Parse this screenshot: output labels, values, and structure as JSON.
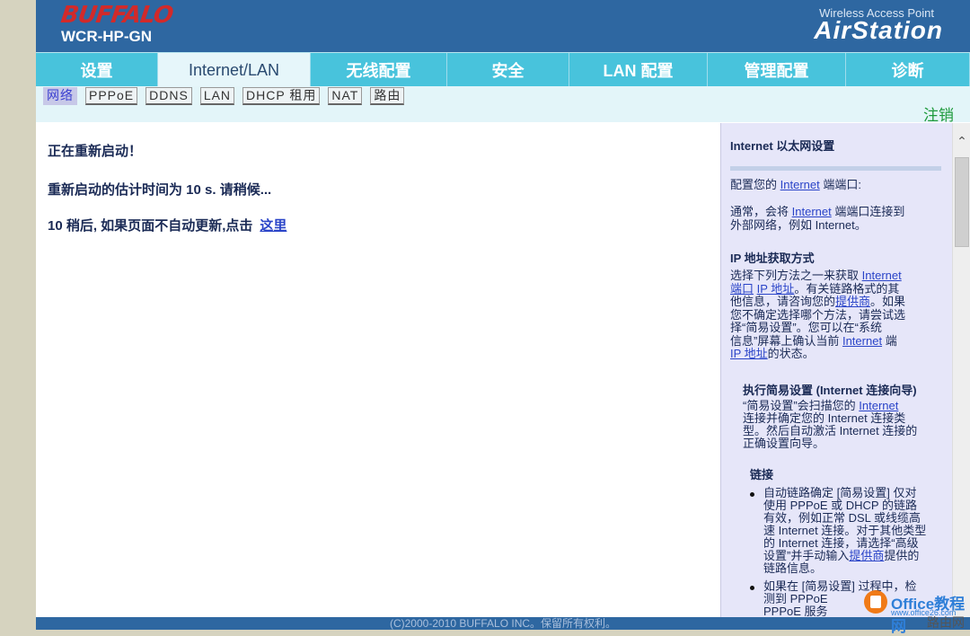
{
  "header": {
    "brand": "BUFFALO",
    "model": "WCR-HP-GN",
    "product_sub": "Wireless Access Point",
    "product": "AirStation"
  },
  "nav": {
    "tabs": [
      {
        "label": "设置",
        "active": false
      },
      {
        "label": "Internet/LAN",
        "active": true
      },
      {
        "label": "无线配置",
        "active": false
      },
      {
        "label": "安全",
        "active": false
      },
      {
        "label": "LAN 配置",
        "active": false
      },
      {
        "label": "管理配置",
        "active": false
      },
      {
        "label": "诊断",
        "active": false
      }
    ]
  },
  "subnav": {
    "tabs": [
      {
        "label": "网络",
        "active": true
      },
      {
        "label": "PPPoE",
        "active": false
      },
      {
        "label": "DDNS",
        "active": false
      },
      {
        "label": "LAN",
        "active": false
      },
      {
        "label": "DHCP 租用",
        "active": false
      },
      {
        "label": "NAT",
        "active": false
      },
      {
        "label": "路由",
        "active": false
      }
    ],
    "logout": "注销"
  },
  "content": {
    "line1": "正在重新启动！",
    "line2": "重新启动的估计时间为 10 s. 请稍候...",
    "line3": "10 稍后, 如果页面不自动更新,点击",
    "link": "这里"
  },
  "help": {
    "title": "Internet 以太网设置",
    "p1a": "配置您的",
    "p1link": "Internet",
    "p1b": "端端口:",
    "p2a": "通常，会将",
    "p2link": "Internet",
    "p2b": "端端口连接到",
    "p2c": "外部网络，例如 Internet。",
    "sec1": "IP 地址获取方式",
    "s1l1a": "选择下列方法之一来获取",
    "s1l1link": "Internet",
    "s1l2link1": "端口",
    "s1l2link2": "IP 地址",
    "s1l2b": "。有关链路格式的其",
    "s1l3a": "他信息，请咨询您的",
    "s1l3link": "提供商",
    "s1l3b": "。如果",
    "s1l4": "您不确定选择哪个方法，请尝试选",
    "s1l5": "择“简易设置”。您可以在“系统",
    "s1l6a": "信息”屏幕上确认当前",
    "s1l6link": "Internet",
    "s1l6b": "端",
    "s1l7link": "IP 地址",
    "s1l7b": "的状态。",
    "sec2": "执行简易设置 (Internet 连接向导)",
    "s2l1a": "“简易设置”会扫描您的",
    "s2l1link": "Internet",
    "s2l2": "连接并确定您的 Internet 连接类",
    "s2l3": "型。然后自动激活 Internet 连接的",
    "s2l4": "正确设置向导。",
    "sec3": "链接",
    "b1l1": "自动链路确定 [简易设置] 仅对",
    "b1l2": "使用 PPPoE 或 DHCP 的链路",
    "b1l3": "有效，例如正常 DSL 或线缆高",
    "b1l4": "速 Internet 连接。对于其他类型",
    "b1l5": "的 Internet 连接，请选择“高级",
    "b1l6a": "设置”并手动输入",
    "b1l6link": "提供商",
    "b1l6b": "提供的",
    "b1l7": "链路信息。",
    "b2l1": "如果在 [简易设置] 过程中，检",
    "b2l2": "测到 PPPoE",
    "b2l3": "PPPoE 服务"
  },
  "footer": {
    "copyright": "(C)2000-2010 BUFFALO INC。保留所有权利。"
  },
  "watermark": {
    "site": "Office教程网",
    "url": "www.office26.com",
    "sub": "路由网"
  }
}
